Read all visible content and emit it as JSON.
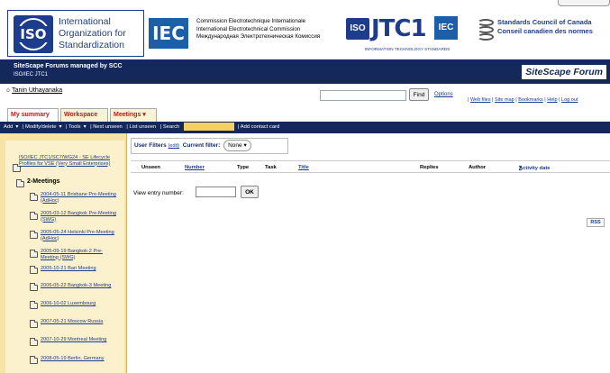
{
  "header": {
    "iso_logo_text": "ISO",
    "iso_name": "International Organization for Standardization",
    "iec_logo_text": "IEC",
    "iec_names": [
      "Commission Electrotechnique Internationale",
      "International Electrotechnical Commission",
      "Международная Электротехническая Комиссия"
    ],
    "jtc1_iso": "ISO",
    "jtc1_text": "JTC1",
    "jtc1_iec": "IEC",
    "jtc1_sub": "INFORMATION TECHNOLOGY STANDARDS",
    "scc_en": "Standards Council of Canada",
    "scc_fr": "Conseil canadien des normes"
  },
  "bar": {
    "title": "SiteScape Forums managed by SCC",
    "subtitle": "ISO/IEC JTC1",
    "brand": "SiteScape Forum"
  },
  "user": {
    "name": "Tanin Uthayanaka"
  },
  "find": {
    "button": "Find",
    "options": "Options",
    "links": [
      "Web files",
      "Site map",
      "Bookmarks",
      "Help",
      "Log out"
    ]
  },
  "tabs": [
    "My summary",
    "Workspace",
    "Meetings"
  ],
  "menu": [
    "Add",
    "Modify/delete",
    "Tools",
    "Next unseen",
    "List unseen",
    "Search",
    "Add contact card"
  ],
  "sidebar": {
    "crumb": "ISO/IEC JTC1/SC7/WG24 - SE Lifecycle Profiles for VSE (Very Small Enterprises)",
    "folder_heading": "2-Meetings",
    "items": [
      "2004-05-11 Brisbane Pre-Meeting (AdHoc)",
      "2005-03-12 Bangkok Pre-Meeting (SWG)",
      "2005-05-24 Helsinki Pre-Meeting (AdHoc)",
      "2005-09-19 Bangkok-2 Pre-Meeting (SWG)",
      "2005-10-21 Bari Meeting",
      "2006-05-22 Bangkok-3 Meeting",
      "2006-10-02 Luxembourg",
      "2007-05-21 Moscow Russia",
      "2007-10-29 Montreal Meeting",
      "2008-05-19 Berlin, Germany"
    ]
  },
  "filters": {
    "label": "User Filters",
    "edit": "(edit)",
    "current_label": "Current filter:",
    "current_value": "None"
  },
  "columns": [
    "Unseen",
    "Number",
    "Type",
    "Task",
    "Title",
    "Replies",
    "Author",
    "Activity date"
  ],
  "view_entry": {
    "label": "View entry number:",
    "button": "OK"
  },
  "rss": "RSS"
}
